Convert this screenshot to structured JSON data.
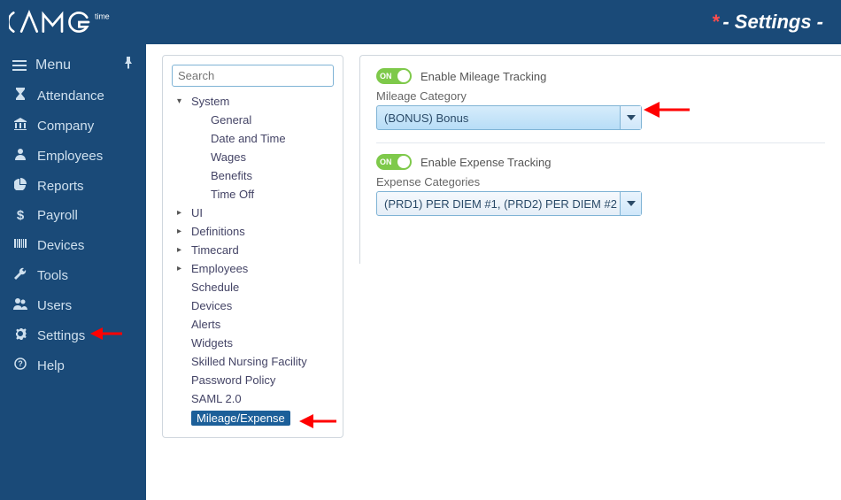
{
  "header": {
    "page_title_prefix": "*",
    "page_title": "- Settings -"
  },
  "sidebar": {
    "menu_label": "Menu",
    "items": [
      {
        "label": "Attendance",
        "icon": "hourglass"
      },
      {
        "label": "Company",
        "icon": "bank"
      },
      {
        "label": "Employees",
        "icon": "person"
      },
      {
        "label": "Reports",
        "icon": "pie"
      },
      {
        "label": "Payroll",
        "icon": "dollar"
      },
      {
        "label": "Devices",
        "icon": "barcode"
      },
      {
        "label": "Tools",
        "icon": "wrench"
      },
      {
        "label": "Users",
        "icon": "users"
      },
      {
        "label": "Settings",
        "icon": "gear"
      },
      {
        "label": "Help",
        "icon": "question"
      }
    ]
  },
  "tree": {
    "search_placeholder": "Search",
    "system_label": "System",
    "system_children": [
      "General",
      "Date and Time",
      "Wages",
      "Benefits",
      "Time Off"
    ],
    "nodes": [
      "UI",
      "Definitions",
      "Timecard",
      "Employees"
    ],
    "flat": [
      "Schedule",
      "Devices",
      "Alerts",
      "Widgets",
      "Skilled Nursing Facility",
      "Password Policy",
      "SAML 2.0",
      "Mileage/Expense"
    ],
    "selected": "Mileage/Expense"
  },
  "content": {
    "toggle_on_text": "ON",
    "mileage": {
      "toggle_label": "Enable Mileage Tracking",
      "field_label": "Mileage Category",
      "value": "(BONUS) Bonus"
    },
    "expense": {
      "toggle_label": "Enable Expense Tracking",
      "field_label": "Expense Categories",
      "value": "(PRD1) PER DIEM #1, (PRD2) PER DIEM #2"
    }
  }
}
